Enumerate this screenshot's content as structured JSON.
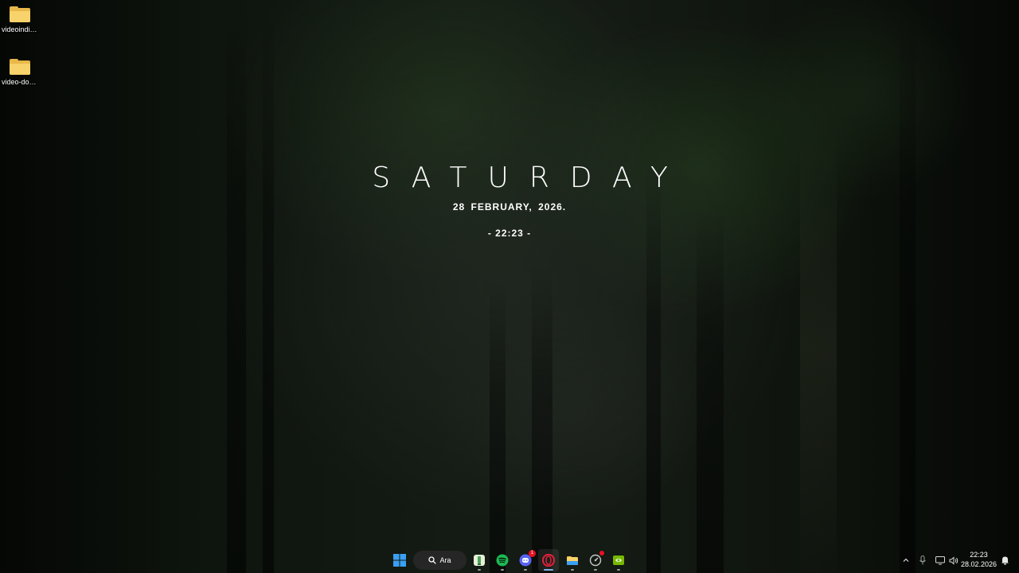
{
  "desktop": {
    "icons": [
      {
        "label": "videoindiric...",
        "icon": "folder-icon"
      },
      {
        "label": "video-dow...",
        "icon": "folder-icon"
      }
    ]
  },
  "widget": {
    "day": "SATURDAY",
    "date": "28 FEBRUARY, 2026.",
    "time": "- 22:23 -"
  },
  "taskbar": {
    "start_icon": "windows-logo-icon",
    "search_label": "Ara",
    "apps": [
      {
        "name": "notepad-app-icon",
        "running": true
      },
      {
        "name": "spotify-icon",
        "running": true
      },
      {
        "name": "discord-icon",
        "running": true,
        "badge": "1"
      },
      {
        "name": "opera-gx-icon",
        "running": true,
        "active": true
      },
      {
        "name": "file-explorer-icon",
        "running": true
      },
      {
        "name": "system-monitor-icon",
        "running": true,
        "badge_dot": true
      },
      {
        "name": "nvidia-icon",
        "running": true
      }
    ],
    "tray": {
      "icons": [
        "chevron-up-icon",
        "microphone-icon",
        "display-icon",
        "speaker-icon"
      ],
      "time": "22:23",
      "date": "28.02.2026",
      "notification_icon": "notification-bell-icon"
    }
  },
  "colors": {
    "folder": "#f8d26a",
    "spotify": "#1db954",
    "discord": "#5865f2",
    "opera": "#e1203a",
    "nvidia": "#76b900",
    "badge": "#e81123"
  }
}
